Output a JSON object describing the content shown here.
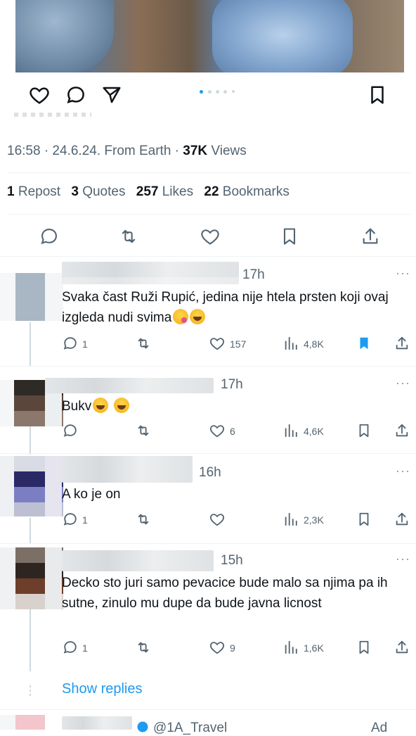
{
  "post": {
    "time_line_prefix": "16:58 · 24.6.24. From Earth · ",
    "views_count": "37K",
    "views_label": " Views",
    "reposts": {
      "count": "1",
      "label": "Repost"
    },
    "quotes": {
      "count": "3",
      "label": "Quotes"
    },
    "likes": {
      "count": "257",
      "label": "Likes"
    },
    "bookmarks": {
      "count": "22",
      "label": "Bookmarks"
    }
  },
  "replies": [
    {
      "time": "17h",
      "text_main": "Svaka čast Ruži Rupić, jedina nije htela prsten koji ovaj izgleda nudi svima",
      "emojis": [
        "wink",
        "laugh"
      ],
      "reply_count": "1",
      "like_count": "157",
      "view_count": "4,8K",
      "bookmarked": true
    },
    {
      "time": "17h",
      "text_main": "Bukv",
      "emojis": [
        "laugh",
        "laugh"
      ],
      "reply_count": "",
      "like_count": "6",
      "view_count": "4,6K",
      "bookmarked": false
    },
    {
      "time": "16h",
      "text_main": "A ko je on",
      "emojis": [],
      "reply_count": "1",
      "like_count": "",
      "view_count": "2,3K",
      "bookmarked": false
    },
    {
      "time": "15h",
      "text_main": "Decko sto juri samo pevacice bude malo sa njima pa ih sutne, zinulo mu dupe da bude javna licnost",
      "emojis": [],
      "reply_count": "1",
      "like_count": "9",
      "view_count": "1,6K",
      "bookmarked": false
    }
  ],
  "show_replies": "Show replies",
  "ad_row": {
    "handle": "@1A_Travel",
    "ad_label": "Ad"
  },
  "more_label": "···",
  "icons": {
    "post_like": "heart-icon",
    "post_reply": "reply-icon",
    "post_share": "share-icon",
    "post_bookmark": "bookmark-icon",
    "retweet": "retweet-icon",
    "views": "views-icon",
    "upload": "upload-icon"
  },
  "colors": {
    "accent": "#1d9bf0",
    "secondary_text": "#536471",
    "divider": "#eff3f4"
  }
}
